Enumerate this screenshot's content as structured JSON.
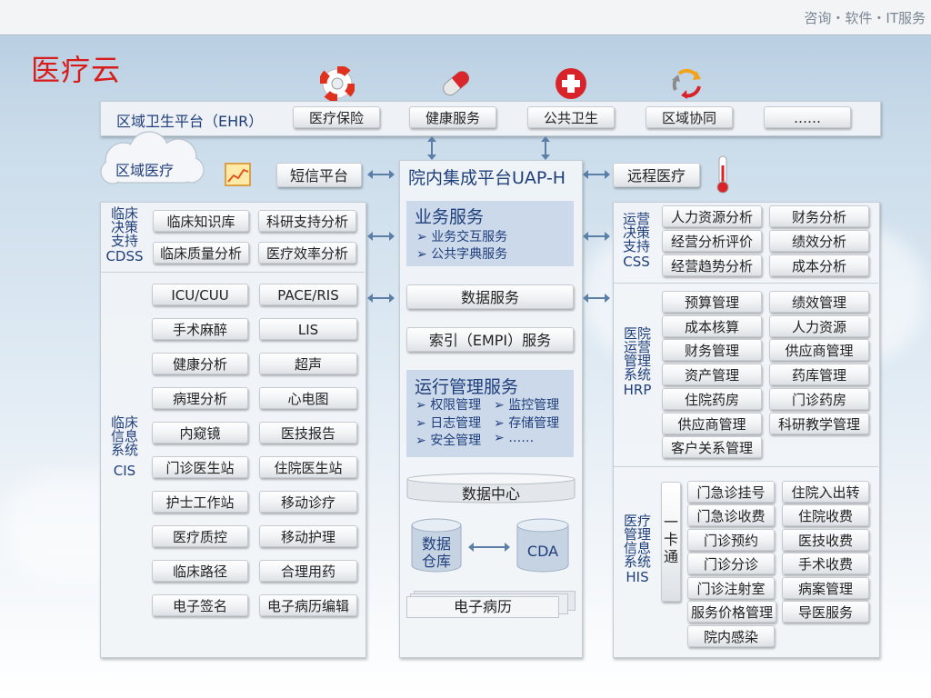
{
  "header": {
    "tagline": "咨询・软件・IT服务"
  },
  "page_title": "医疗云",
  "ehr": {
    "label": "区域卫生平台（EHR）",
    "items": [
      "医疗保险",
      "健康服务",
      "公共卫生",
      "区域协同",
      "……"
    ]
  },
  "region": {
    "cloud_label": "区域医疗",
    "sms": "短信平台",
    "remote": "远程医疗"
  },
  "uap": {
    "title": "院内集成平台UAP-H",
    "business": {
      "title": "业务服务",
      "items": [
        "业务交互服务",
        "公共字典服务"
      ]
    },
    "data_service": "数据服务",
    "index_service": "索引（EMPI）服务",
    "ops": {
      "title": "运行管理服务",
      "items": [
        "权限管理",
        "监控管理",
        "日志管理",
        "存储管理",
        "安全管理",
        "……"
      ]
    },
    "data_center": "数据中心",
    "warehouse": [
      "数据",
      "仓库"
    ],
    "cda": "CDA",
    "emr": "电子病历"
  },
  "cdss": {
    "label": [
      "临床",
      "决策",
      "支持"
    ],
    "abbr": "CDSS",
    "items": [
      "临床知识库",
      "科研支持分析",
      "临床质量分析",
      "医疗效率分析"
    ]
  },
  "cis": {
    "label": [
      "临床",
      "信息",
      "系统"
    ],
    "abbr": "CIS",
    "items": [
      "ICU/CUU",
      "PACE/RIS",
      "手术麻醉",
      "LIS",
      "健康分析",
      "超声",
      "病理分析",
      "心电图",
      "内窥镜",
      "医技报告",
      "门诊医生站",
      "住院医生站",
      "护士工作站",
      "移动诊疗",
      "医疗质控",
      "移动护理",
      "临床路径",
      "合理用药",
      "电子签名",
      "电子病历编辑"
    ]
  },
  "css": {
    "label": [
      "运营",
      "决策",
      "支持"
    ],
    "abbr": "CSS",
    "items": [
      "人力资源分析",
      "财务分析",
      "经营分析评价",
      "绩效分析",
      "经营趋势分析",
      "成本分析"
    ]
  },
  "hrp": {
    "label": [
      "医院",
      "运营",
      "管理",
      "系统"
    ],
    "abbr": "HRP",
    "items": [
      "预算管理",
      "绩效管理",
      "成本核算",
      "人力资源",
      "财务管理",
      "供应商管理",
      "资产管理",
      "药库管理",
      "住院药房",
      "门诊药房",
      "供应商管理",
      "科研教学管理",
      "客户关系管理"
    ]
  },
  "his": {
    "label": [
      "医疗",
      "管理",
      "信息",
      "系统"
    ],
    "abbr": "HIS",
    "card": [
      "一",
      "卡",
      "通"
    ],
    "items": [
      "门急诊挂号",
      "住院入出转",
      "门急诊收费",
      "住院收费",
      "门诊预约",
      "医技收费",
      "门诊分诊",
      "手术收费",
      "门诊注射室",
      "病案管理",
      "服务价格管理",
      "导医服务",
      "院内感染"
    ]
  },
  "icons": [
    "lifebuoy-icon",
    "pill-icon",
    "medical-cross-icon",
    "recycle-arrows-icon",
    "chart-icon",
    "thermometer-icon"
  ],
  "colors": {
    "title_red": "#d81b1b",
    "label_blue": "#1f3e7a",
    "box_blue": "#cbd9ea"
  }
}
